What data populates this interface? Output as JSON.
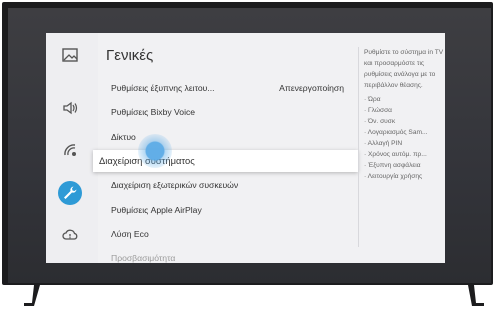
{
  "window": {
    "title": "Γενικές"
  },
  "categories": [
    {
      "name": "picture",
      "icon": "picture-icon",
      "selected": false
    },
    {
      "name": "sound",
      "icon": "speaker-icon",
      "selected": false
    },
    {
      "name": "broadcasting",
      "icon": "satellite-icon",
      "selected": false
    },
    {
      "name": "general",
      "icon": "wrench-icon",
      "selected": true
    },
    {
      "name": "support",
      "icon": "cloud-support-icon",
      "selected": false
    }
  ],
  "menu": {
    "items": [
      {
        "label": "Ρυθμίσεις έξυπνης λειτου...",
        "value": "Απενεργοποίηση"
      },
      {
        "label": "Ρυθμίσεις Bixby Voice",
        "value": ""
      },
      {
        "label": "Δίκτυο",
        "value": ""
      },
      {
        "label": "Διαχείριση συστήματος",
        "value": ""
      },
      {
        "label": "Διαχείριση εξωτερικών συσκευών",
        "value": ""
      },
      {
        "label": "Ρυθμίσεις Apple AirPlay",
        "value": ""
      },
      {
        "label": "Λύση Eco",
        "value": ""
      },
      {
        "label": "Προσβασιμότητα",
        "value": ""
      }
    ],
    "focused_index": 3
  },
  "help": {
    "description": "Ρυθμίστε το σύστημα in TV και προσαρμόστε τις ρυθμίσεις ανάλογα με το περιβάλλον θέασης.",
    "items": [
      "Ώρα",
      "Γλώσσα",
      "Όν. συσκ",
      "Λογαριασμός Sam...",
      "Αλλαγή PIN",
      "Χρόνος αυτόμ. πρ...",
      "Έξυπνη ασφάλεια",
      "Λειτουργία χρήσης"
    ]
  },
  "colors": {
    "accent": "#2e9ad6",
    "panel": "#f1f1f3",
    "bezel": "#1c1c1e"
  }
}
